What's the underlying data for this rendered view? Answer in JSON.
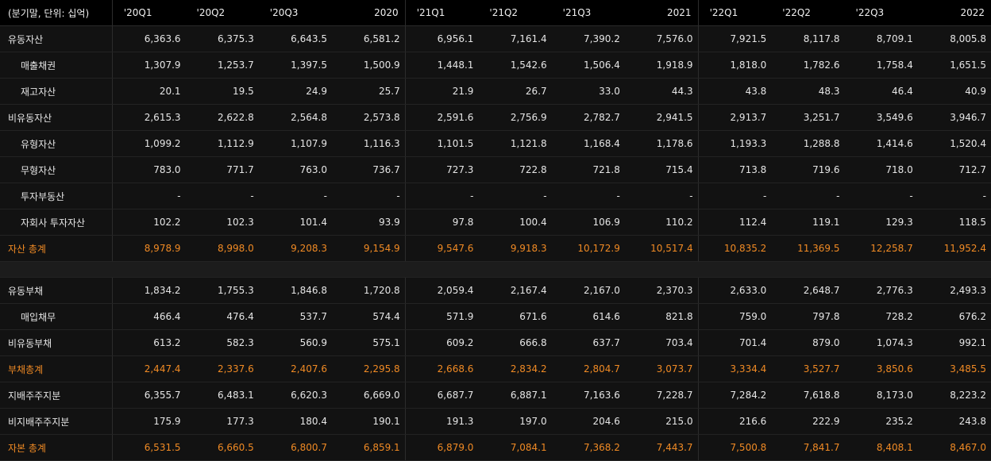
{
  "header": {
    "label": "(분기말, 단위: 십억)",
    "columns": [
      "'20Q1",
      "'20Q2",
      "'20Q3",
      "2020",
      "'21Q1",
      "'21Q2",
      "'21Q3",
      "2021",
      "'22Q1",
      "'22Q2",
      "'22Q3",
      "2022"
    ]
  },
  "rows": [
    {
      "label": "유동자산",
      "indent": false,
      "total": false,
      "values": [
        "6,363.6",
        "6,375.3",
        "6,643.5",
        "6,581.2",
        "6,956.1",
        "7,161.4",
        "7,390.2",
        "7,576.0",
        "7,921.5",
        "8,117.8",
        "8,709.1",
        "8,005.8"
      ]
    },
    {
      "label": "매출채권",
      "indent": true,
      "total": false,
      "values": [
        "1,307.9",
        "1,253.7",
        "1,397.5",
        "1,500.9",
        "1,448.1",
        "1,542.6",
        "1,506.4",
        "1,918.9",
        "1,818.0",
        "1,782.6",
        "1,758.4",
        "1,651.5"
      ]
    },
    {
      "label": "재고자산",
      "indent": true,
      "total": false,
      "values": [
        "20.1",
        "19.5",
        "24.9",
        "25.7",
        "21.9",
        "26.7",
        "33.0",
        "44.3",
        "43.8",
        "48.3",
        "46.4",
        "40.9"
      ]
    },
    {
      "label": "비유동자산",
      "indent": false,
      "total": false,
      "values": [
        "2,615.3",
        "2,622.8",
        "2,564.8",
        "2,573.8",
        "2,591.6",
        "2,756.9",
        "2,782.7",
        "2,941.5",
        "2,913.7",
        "3,251.7",
        "3,549.6",
        "3,946.7"
      ]
    },
    {
      "label": "유형자산",
      "indent": true,
      "total": false,
      "values": [
        "1,099.2",
        "1,112.9",
        "1,107.9",
        "1,116.3",
        "1,101.5",
        "1,121.8",
        "1,168.4",
        "1,178.6",
        "1,193.3",
        "1,288.8",
        "1,414.6",
        "1,520.4"
      ]
    },
    {
      "label": "무형자산",
      "indent": true,
      "total": false,
      "values": [
        "783.0",
        "771.7",
        "763.0",
        "736.7",
        "727.3",
        "722.8",
        "721.8",
        "715.4",
        "713.8",
        "719.6",
        "718.0",
        "712.7"
      ]
    },
    {
      "label": "투자부동산",
      "indent": true,
      "total": false,
      "values": [
        "-",
        "-",
        "-",
        "-",
        "-",
        "-",
        "-",
        "-",
        "-",
        "-",
        "-",
        "-"
      ]
    },
    {
      "label": "자회사 투자자산",
      "indent": true,
      "total": false,
      "values": [
        "102.2",
        "102.3",
        "101.4",
        "93.9",
        "97.8",
        "100.4",
        "106.9",
        "110.2",
        "112.4",
        "119.1",
        "129.3",
        "118.5"
      ]
    },
    {
      "label": "자산 총계",
      "indent": false,
      "total": true,
      "values": [
        "8,978.9",
        "8,998.0",
        "9,208.3",
        "9,154.9",
        "9,547.6",
        "9,918.3",
        "10,172.9",
        "10,517.4",
        "10,835.2",
        "11,369.5",
        "12,258.7",
        "11,952.4"
      ]
    },
    {
      "spacer": true
    },
    {
      "label": "유동부채",
      "indent": false,
      "total": false,
      "values": [
        "1,834.2",
        "1,755.3",
        "1,846.8",
        "1,720.8",
        "2,059.4",
        "2,167.4",
        "2,167.0",
        "2,370.3",
        "2,633.0",
        "2,648.7",
        "2,776.3",
        "2,493.3"
      ]
    },
    {
      "label": "매입채무",
      "indent": true,
      "total": false,
      "values": [
        "466.4",
        "476.4",
        "537.7",
        "574.4",
        "571.9",
        "671.6",
        "614.6",
        "821.8",
        "759.0",
        "797.8",
        "728.2",
        "676.2"
      ]
    },
    {
      "label": "비유동부채",
      "indent": false,
      "total": false,
      "values": [
        "613.2",
        "582.3",
        "560.9",
        "575.1",
        "609.2",
        "666.8",
        "637.7",
        "703.4",
        "701.4",
        "879.0",
        "1,074.3",
        "992.1"
      ]
    },
    {
      "label": "부채총계",
      "indent": false,
      "total": true,
      "values": [
        "2,447.4",
        "2,337.6",
        "2,407.6",
        "2,295.8",
        "2,668.6",
        "2,834.2",
        "2,804.7",
        "3,073.7",
        "3,334.4",
        "3,527.7",
        "3,850.6",
        "3,485.5"
      ]
    },
    {
      "label": "지배주주지분",
      "indent": false,
      "total": false,
      "values": [
        "6,355.7",
        "6,483.1",
        "6,620.3",
        "6,669.0",
        "6,687.7",
        "6,887.1",
        "7,163.6",
        "7,228.7",
        "7,284.2",
        "7,618.8",
        "8,173.0",
        "8,223.2"
      ]
    },
    {
      "label": "비지배주주지분",
      "indent": false,
      "total": false,
      "values": [
        "175.9",
        "177.3",
        "180.4",
        "190.1",
        "191.3",
        "197.0",
        "204.6",
        "215.0",
        "216.6",
        "222.9",
        "235.2",
        "243.8"
      ]
    },
    {
      "label": "자본 총계",
      "indent": false,
      "total": true,
      "values": [
        "6,531.5",
        "6,660.5",
        "6,800.7",
        "6,859.1",
        "6,879.0",
        "7,084.1",
        "7,368.2",
        "7,443.7",
        "7,500.8",
        "7,841.7",
        "8,408.1",
        "8,467.0"
      ]
    }
  ],
  "colors": {
    "background": "#121212",
    "header_bg": "#000000",
    "total_text": "#f08a24",
    "text": "#e6e6e6"
  }
}
